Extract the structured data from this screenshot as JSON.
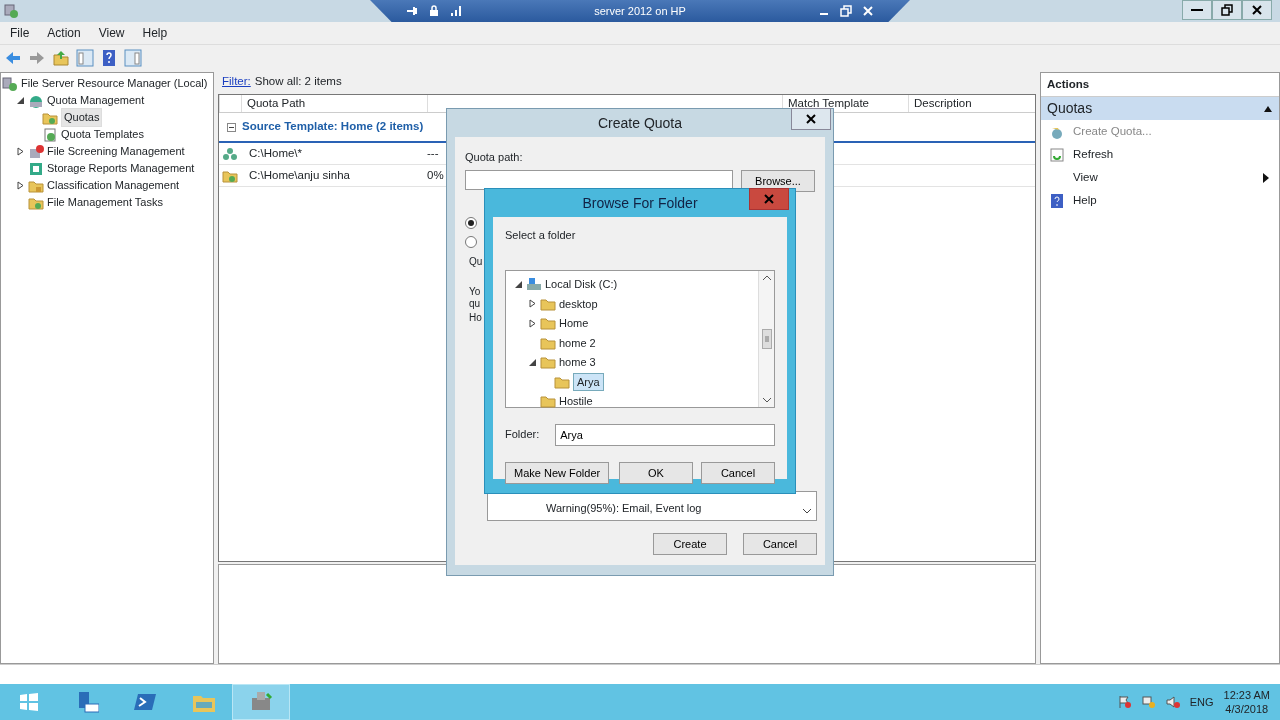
{
  "remote_bar": {
    "title": "server 2012 on HP"
  },
  "menu": [
    "File",
    "Action",
    "View",
    "Help"
  ],
  "tree": [
    {
      "label": "File Server Resource Manager (Local)",
      "selected": false,
      "children": [
        {
          "label": "Quota Management",
          "expanded": true,
          "selected": false,
          "children": [
            {
              "label": "Quotas",
              "selected": true
            },
            {
              "label": "Quota Templates",
              "selected": false
            }
          ]
        },
        {
          "label": "File Screening Management",
          "expanded": false,
          "selected": false
        },
        {
          "label": "Storage Reports Management",
          "selected": false
        },
        {
          "label": "Classification Management",
          "expanded": false,
          "selected": false
        },
        {
          "label": "File Management Tasks",
          "selected": false
        }
      ]
    }
  ],
  "filter": {
    "link": "Filter:",
    "text": "Show all: 2 items"
  },
  "table": {
    "columns": [
      "Quota Path",
      "Match Template",
      "Description"
    ],
    "group": {
      "label": "Source Template: Home (2 items)",
      "expanded": true
    },
    "rows": [
      {
        "kind": "auto",
        "path": "C:\\Home\\*",
        "used": "---"
      },
      {
        "kind": "folder",
        "path": "C:\\Home\\anju sinha",
        "used": "0%"
      }
    ]
  },
  "actions": {
    "title": "Actions",
    "section": "Quotas",
    "items": [
      {
        "label": "Create Quota...",
        "disabled": true,
        "submenu": false
      },
      {
        "label": "Refresh",
        "disabled": false,
        "submenu": false
      },
      {
        "label": "View",
        "disabled": false,
        "submenu": true
      },
      {
        "label": "Help",
        "disabled": false,
        "submenu": false
      }
    ]
  },
  "create_quota": {
    "title": "Create Quota",
    "path_label": "Quota path:",
    "browse_button": "Browse...",
    "radios": [
      {
        "selected": true
      },
      {
        "selected": false
      }
    ],
    "fragments": [
      "Qu",
      "Yo",
      "qu",
      "Ho"
    ],
    "warning": "Warning(95%): Email, Event log",
    "buttons": [
      "Create",
      "Cancel"
    ]
  },
  "browse": {
    "title": "Browse For Folder",
    "prompt": "Select a folder",
    "tree": [
      {
        "label": "Local Disk (C:)",
        "kind": "drive",
        "expanded": true,
        "selected": false,
        "children": [
          {
            "label": "desktop",
            "kind": "folder",
            "expanded": false,
            "selected": false
          },
          {
            "label": "Home",
            "kind": "folder",
            "expanded": false,
            "selected": false
          },
          {
            "label": "home 2",
            "kind": "folder",
            "selected": false
          },
          {
            "label": "home 3",
            "kind": "folder",
            "expanded": true,
            "selected": false,
            "children": [
              {
                "label": "Arya",
                "kind": "folder",
                "selected": true
              }
            ]
          },
          {
            "label": "Hostile",
            "kind": "folder",
            "selected": false
          }
        ]
      }
    ],
    "folder_label": "Folder:",
    "folder_value": "Arya",
    "buttons": [
      "Make New Folder",
      "OK",
      "Cancel"
    ]
  },
  "taskbar": {
    "apps": [
      {
        "selected": false
      },
      {
        "selected": false
      },
      {
        "selected": false
      },
      {
        "selected": true
      }
    ],
    "language": "ENG",
    "time": "12:23 AM",
    "date": "4/3/2018"
  }
}
